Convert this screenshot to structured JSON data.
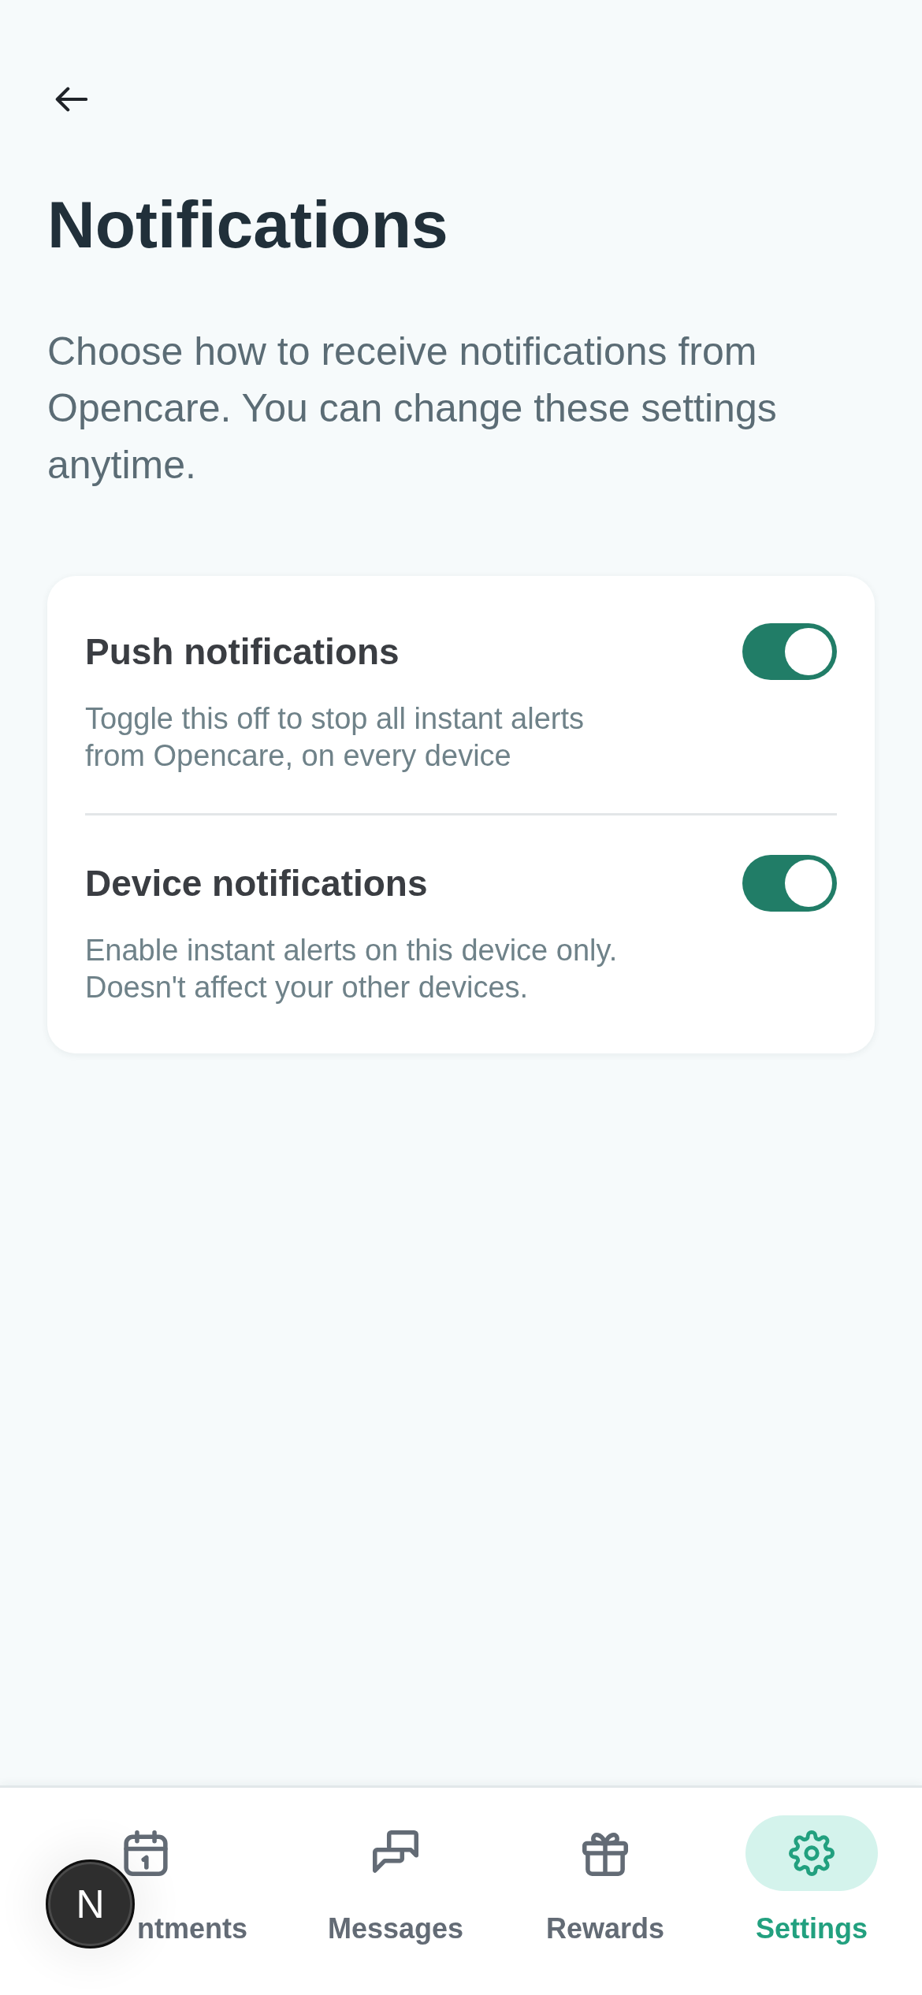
{
  "header": {
    "title": "Notifications",
    "intro": "Choose how to receive notifications from Opencare. You can change these settings anytime."
  },
  "settings": [
    {
      "title": "Push notifications",
      "description": "Toggle this off to stop all instant alerts from Opencare, on every device",
      "on": true
    },
    {
      "title": "Device notifications",
      "description": "Enable instant alerts on this device only. Doesn't affect your other devices.",
      "on": true
    }
  ],
  "tab_bar": [
    {
      "label": "ntments",
      "selected": false
    },
    {
      "label": "Messages",
      "selected": false
    },
    {
      "label": "Rewards",
      "selected": false
    },
    {
      "label": "Settings",
      "selected": true
    }
  ],
  "floating_badge": {
    "letter": "N"
  }
}
